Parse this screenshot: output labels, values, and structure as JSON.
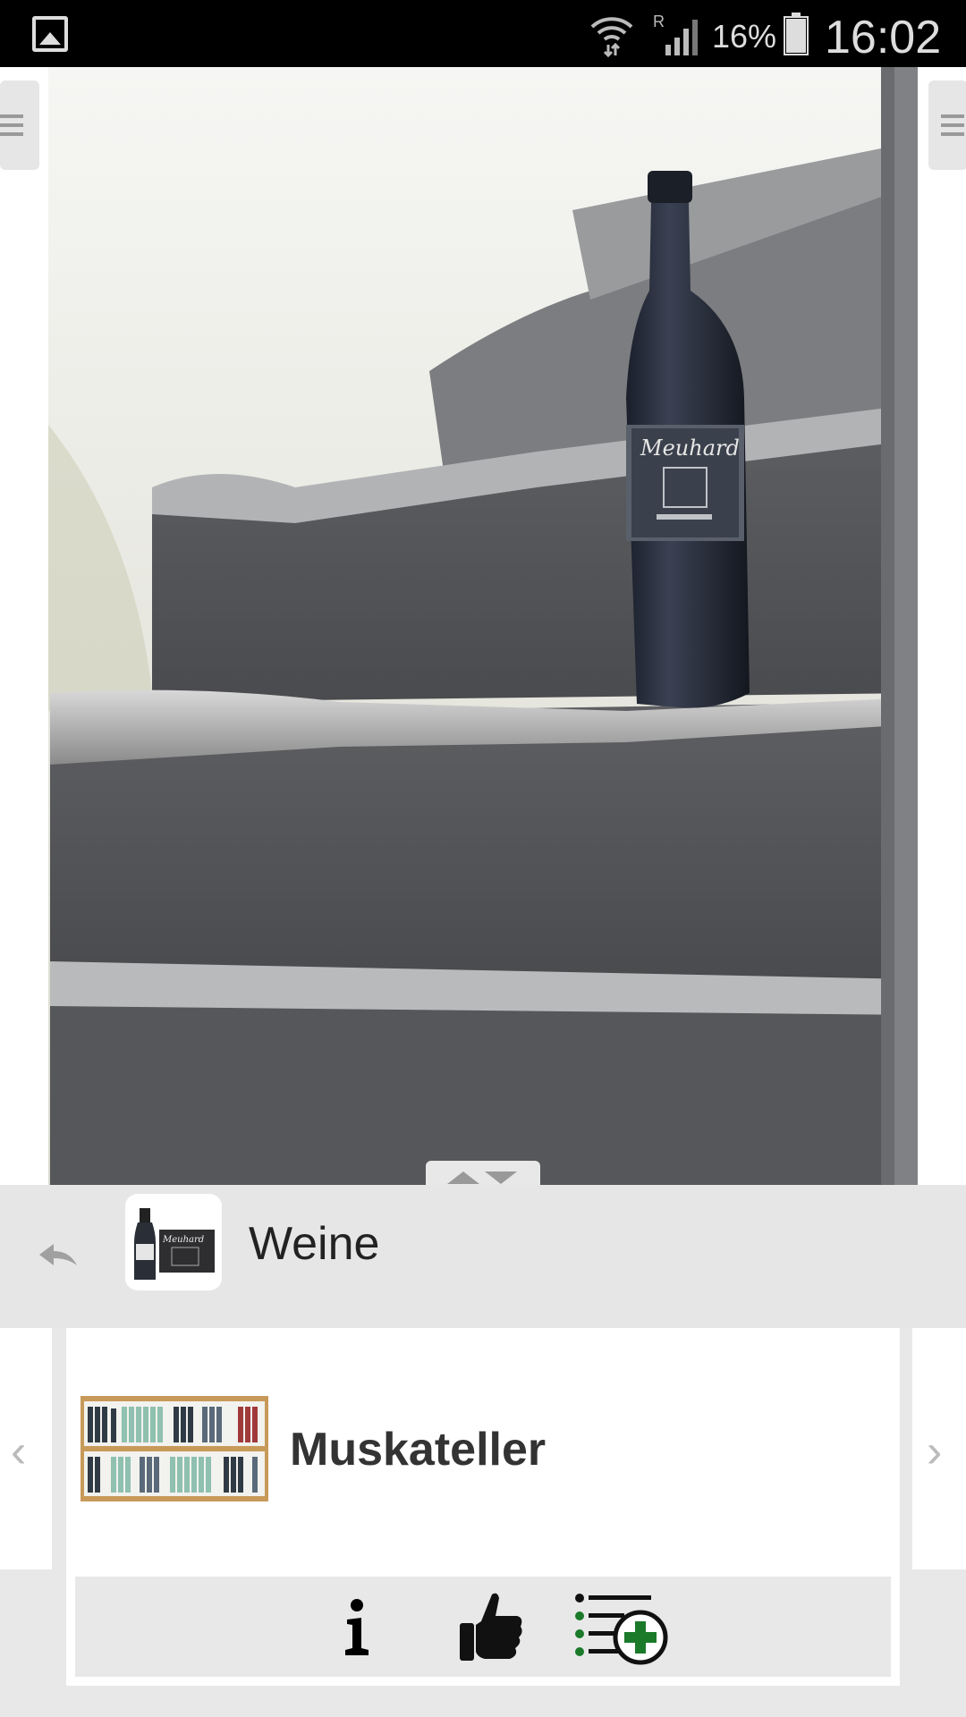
{
  "status_bar": {
    "battery_percent": "16%",
    "time": "16:02",
    "roaming_indicator": "R",
    "icons": [
      "gallery-icon",
      "wifi-icon",
      "signal-icon",
      "battery-icon"
    ]
  },
  "hero": {
    "image": "wine-bottle-on-stone-steps",
    "bottle_label_brand": "Meuhard"
  },
  "category": {
    "title": "Weine",
    "thumb_label": "Meuhard"
  },
  "product": {
    "name": "Muskateller"
  },
  "actions": {
    "icons": [
      "info-icon",
      "thumbs-up-icon",
      "add-to-list-icon"
    ]
  },
  "colors": {
    "status_bar": "#000000",
    "panel_background": "#e6e6e6",
    "accent_green": "#1a7a2a"
  }
}
